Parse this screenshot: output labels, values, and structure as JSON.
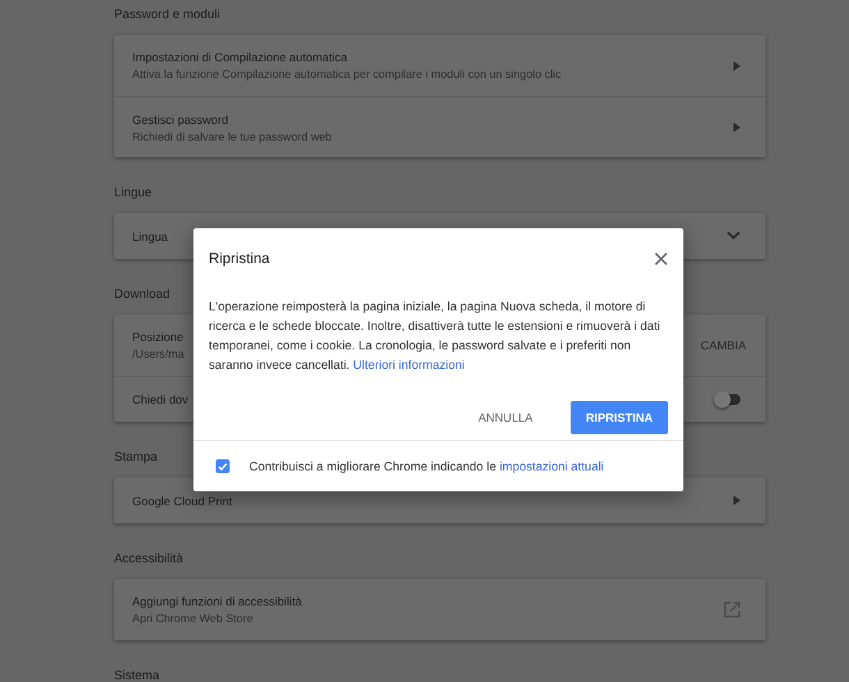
{
  "sections": [
    {
      "title": "Password e moduli",
      "items": [
        {
          "kind": "nav",
          "label": "Impostazioni di Compilazione automatica",
          "sublabel": "Attiva la funzione Compilazione automatica per compilare i moduli con un singolo clic"
        },
        {
          "kind": "nav",
          "label": "Gestisci password",
          "sublabel": "Richiedi di salvare le tue password web"
        }
      ]
    },
    {
      "title": "Lingue",
      "items": [
        {
          "kind": "select",
          "label": "Lingua"
        }
      ]
    },
    {
      "title": "Download",
      "items": [
        {
          "kind": "path",
          "label": "Posizione",
          "sublabel": "/Users/ma",
          "action": "CAMBIA"
        },
        {
          "kind": "toggle",
          "label": "Chiedi dov",
          "on": false
        }
      ]
    },
    {
      "title": "Stampa",
      "items": [
        {
          "kind": "nav",
          "label": "Google Cloud Print"
        }
      ]
    },
    {
      "title": "Accessibilità",
      "items": [
        {
          "kind": "external",
          "label": "Aggiungi funzioni di accessibilità",
          "sublabel": "Apri Chrome Web Store"
        }
      ]
    },
    {
      "title": "Sistema"
    }
  ],
  "dialog": {
    "title": "Ripristina",
    "body": "L'operazione reimposterà la pagina iniziale, la pagina Nuova scheda, il motore di ricerca e le schede bloccate. Inoltre, disattiverà tutte le estensioni e rimuoverà i dati temporanei, come i cookie. La cronologia, le password salvate e i preferiti non saranno invece cancellati.",
    "link": "Ulteriori informazioni",
    "buttons": [
      {
        "label": "ANNULLA",
        "kind": "text"
      },
      {
        "label": "RIPRISTINA",
        "kind": "primary"
      }
    ],
    "footer": {
      "checked": true,
      "text": "Contribuisci a migliorare Chrome indicando le",
      "link": "impostazioni attuali"
    }
  }
}
